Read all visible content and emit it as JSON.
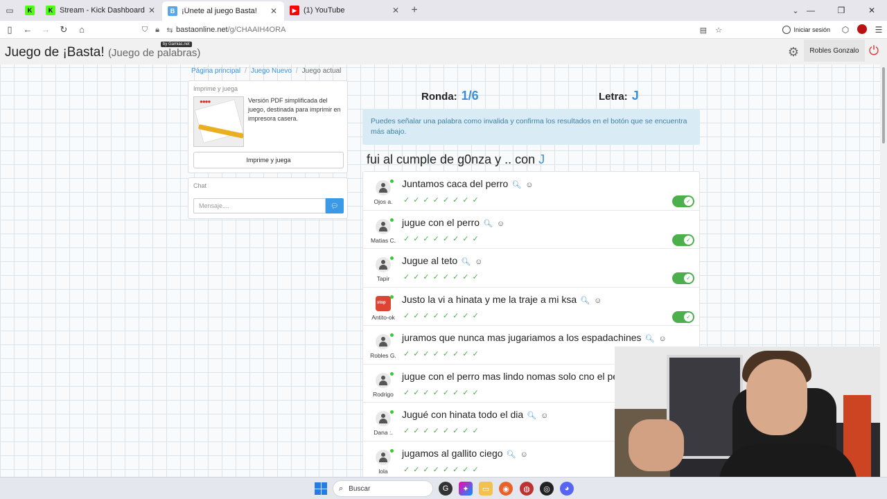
{
  "browser": {
    "tabs": [
      {
        "title": "",
        "icon": "kick-icon"
      },
      {
        "title": "Stream - Kick Dashboard",
        "icon": "kick-icon"
      },
      {
        "title": "¡Únete al juego Basta!",
        "icon": "basta-icon",
        "active": true
      },
      {
        "title": "(1) YouTube",
        "icon": "youtube-icon"
      }
    ],
    "url_host": "bastaonline.net",
    "url_path": "/g/CHAAIH4ORA",
    "sign_in": "Iniciar sesión"
  },
  "header": {
    "title": "Juego de ¡Basta!",
    "subtitle": "(Juego de palabras)",
    "badge": "by Gamiac.net",
    "user": "Robles Gonzalo"
  },
  "breadcrumb": {
    "home": "Página principal",
    "new_game": "Juego Nuevo",
    "current": "Juego actual"
  },
  "print_panel": {
    "title": "Imprime y juega",
    "description": "Versión PDF simplificada del juego, destinada para imprimir en impresora casera.",
    "button": "Imprime y juega"
  },
  "chat": {
    "title": "Chat",
    "placeholder": "Mensaje...."
  },
  "round": {
    "ronda_label": "Ronda:",
    "ronda_value": "1/6",
    "letra_label": "Letra:",
    "letra_value": "J"
  },
  "info": "Puedes señalar una palabra como invalida y confirma los resultados en el botón que se encuentra más abajo.",
  "topic": {
    "text": "fui al cumple de g0nza y .. con",
    "letter": "J"
  },
  "answers": [
    {
      "player": "Ojos a.",
      "text": "Juntamos caca del perro",
      "avatar": "person",
      "valid": true,
      "toggle": true
    },
    {
      "player": "Matias C.",
      "text": "jugue con el perro",
      "avatar": "person",
      "valid": true,
      "toggle": true
    },
    {
      "player": "Tapir",
      "text": "Jugue al teto",
      "avatar": "person",
      "valid": true,
      "toggle": true
    },
    {
      "player": "Antito-ok",
      "text": "Justo la vi a hinata y me la traje a mi ksa",
      "avatar": "stop",
      "valid": true,
      "toggle": true
    },
    {
      "player": "Robles G.",
      "text": "juramos que nunca mas jugariamos a los espadachines",
      "avatar": "person",
      "valid": true,
      "toggle": false
    },
    {
      "player": "Rodrigo",
      "text": "jugue con el perro mas lindo nomas solo cno el pe",
      "avatar": "person",
      "valid": true,
      "toggle": false
    },
    {
      "player": "Dana :.",
      "text": "Jugué con hinata todo el dia",
      "avatar": "person",
      "valid": true,
      "toggle": false
    },
    {
      "player": "lola",
      "text": "jugamos al gallito ciego",
      "avatar": "person",
      "valid": true,
      "toggle": false
    }
  ],
  "check_count": 8,
  "taskbar": {
    "search": "Buscar"
  },
  "colors": {
    "accent": "#3a8fd8",
    "valid": "#4cae4c",
    "info_bg": "#d9ecf5"
  }
}
